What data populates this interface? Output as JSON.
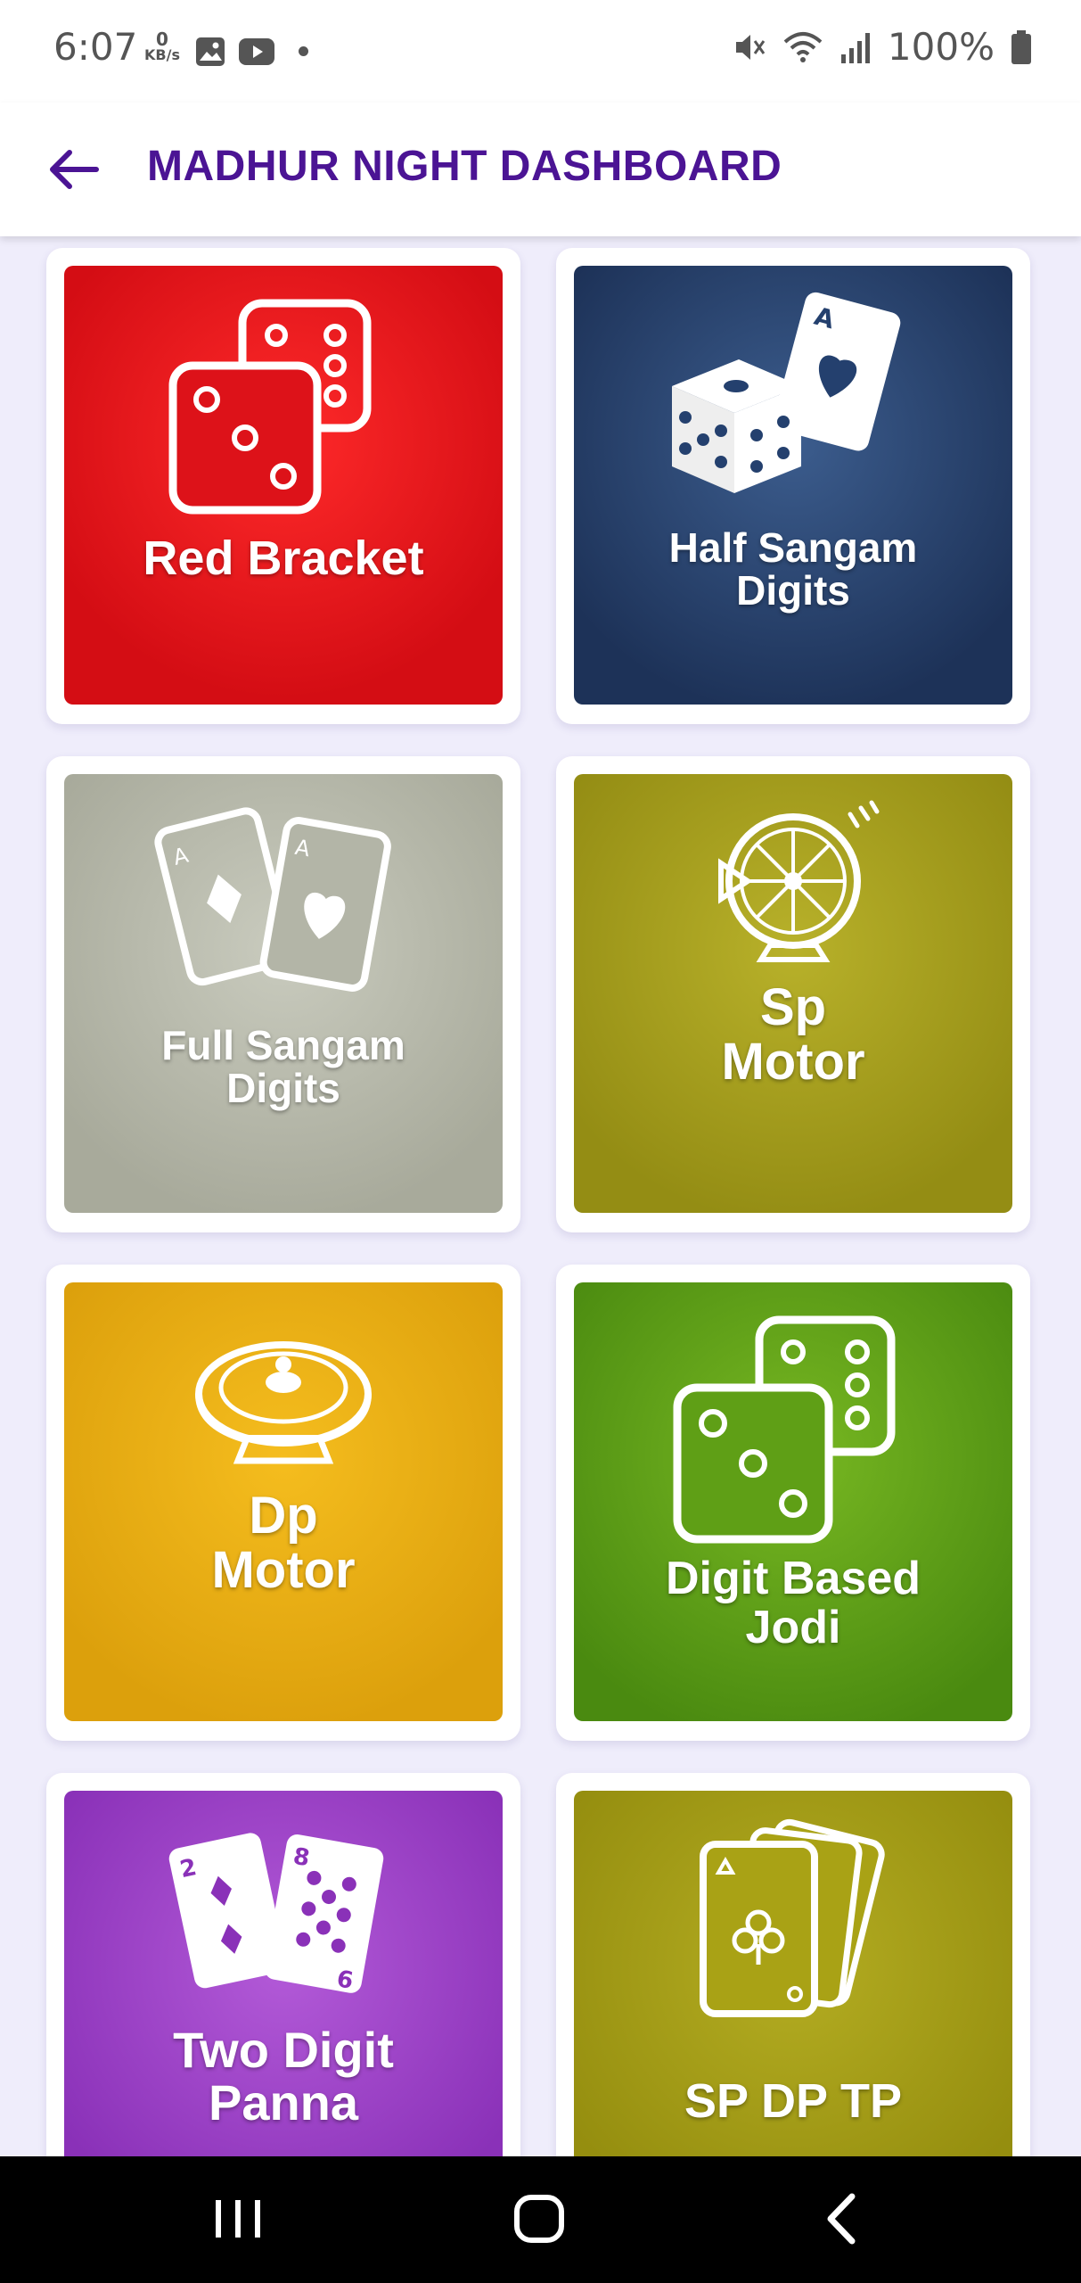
{
  "status_bar": {
    "time": "6:07",
    "net_speed_value": "0",
    "net_speed_unit": "KB/s",
    "battery": "100%"
  },
  "header": {
    "title": "MADHUR NIGHT DASHBOARD",
    "title_color": "#4b1494"
  },
  "tiles": [
    {
      "label_line1": "Red Bracket",
      "label_line2": "",
      "color": "#e6121a",
      "icon": "dice-icon"
    },
    {
      "label_line1": "Half Sangam",
      "label_line2": "Digits",
      "color": "#24406e",
      "icon": "dice-and-card-icon"
    },
    {
      "label_line1": "Full Sangam",
      "label_line2": "Digits",
      "color": "#b9bbad",
      "icon": "playing-cards-icon"
    },
    {
      "label_line1": "Sp",
      "label_line2": "Motor",
      "color": "#a8a11f",
      "icon": "spin-wheel-icon"
    },
    {
      "label_line1": "Dp",
      "label_line2": "Motor",
      "color": "#e8ac12",
      "icon": "roulette-icon"
    },
    {
      "label_line1": "Digit Based",
      "label_line2": "Jodi",
      "color": "#5a9a14",
      "icon": "dice-icon"
    },
    {
      "label_line1": "Two Digit",
      "label_line2": "Panna",
      "color": "#9a3fc4",
      "icon": "playing-cards-icon"
    },
    {
      "label_line1": "SP DP TP",
      "label_line2": "",
      "color": "#a9a215",
      "icon": "card-stack-icon"
    }
  ]
}
